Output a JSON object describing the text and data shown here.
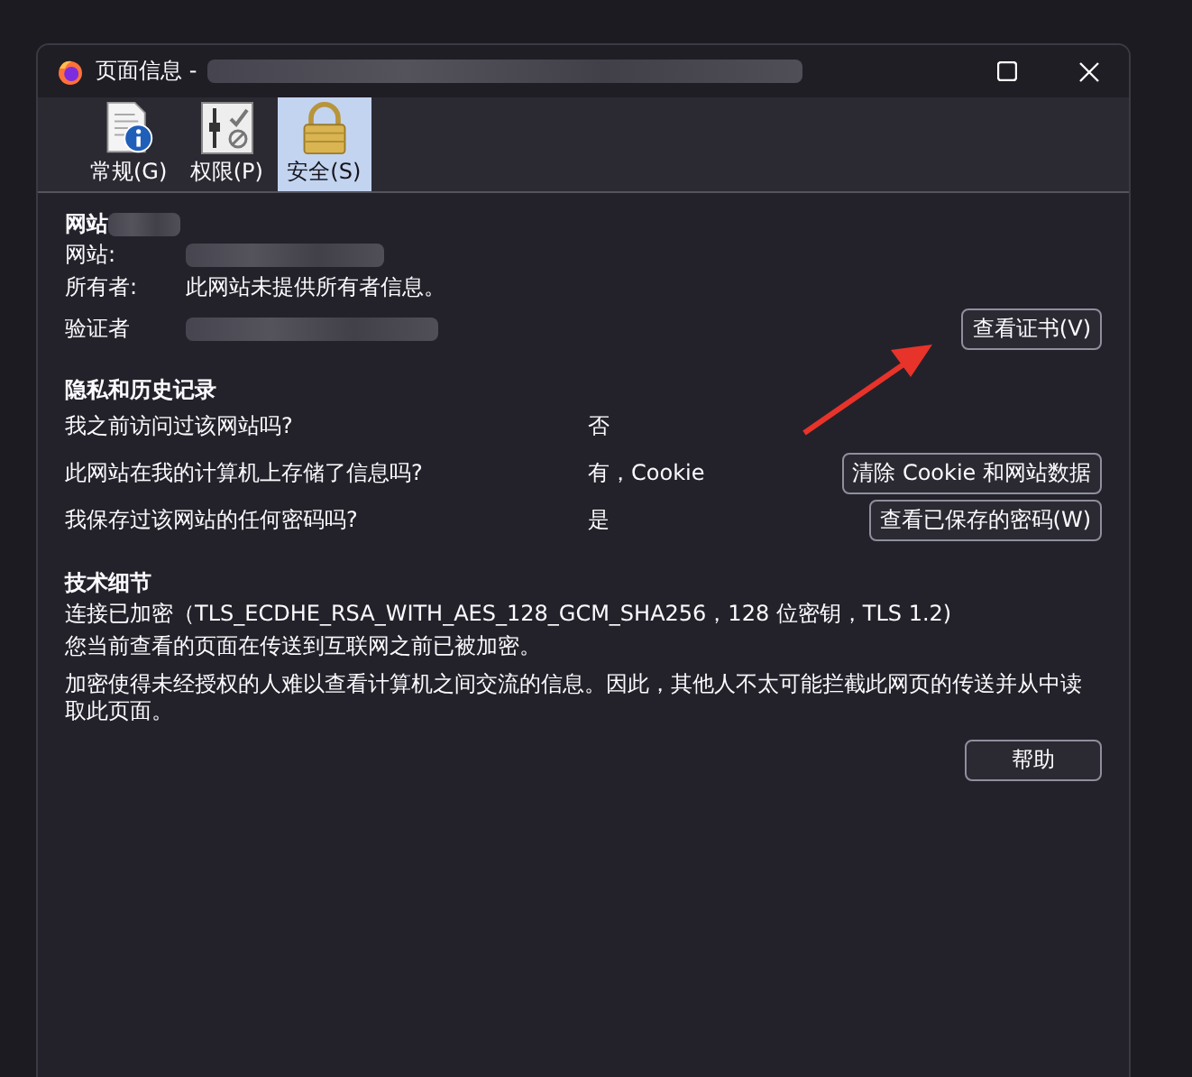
{
  "window": {
    "title": "页面信息 -",
    "title_redacted": true
  },
  "tabs": [
    {
      "label": "常规(G)",
      "kind": "info",
      "selected": false
    },
    {
      "label": "权限(P)",
      "kind": "permissions",
      "selected": false
    },
    {
      "label": "安全(S)",
      "kind": "lock",
      "selected": true
    }
  ],
  "identity": {
    "heading": "网站",
    "heading_redacted": true,
    "rows": [
      {
        "label": "网站:",
        "redacted": true
      },
      {
        "label": "所有者:",
        "value": "此网站未提供所有者信息。",
        "redacted": false
      },
      {
        "label": "验证者",
        "redacted": true
      }
    ],
    "button": "查看证书(V)"
  },
  "privacy": {
    "heading": "隐私和历史记录",
    "rows": [
      {
        "question": "我之前访问过该网站吗?",
        "answer": "否"
      },
      {
        "question": "此网站在我的计算机上存储了信息吗?",
        "answer": "有，Cookie",
        "button": "清除 Cookie 和网站数据"
      },
      {
        "question": "我保存过该网站的任何密码吗?",
        "answer": "是",
        "button": "查看已保存的密码(W)"
      }
    ]
  },
  "technical": {
    "heading": "技术细节",
    "lines": [
      "连接已加密（TLS_ECDHE_RSA_WITH_AES_128_GCM_SHA256，128 位密钥，TLS 1.2)",
      "您当前查看的页面在传送到互联网之前已被加密。",
      "加密使得未经授权的人难以查看计算机之间交流的信息。因此，其他人不太可能拦截此网页的传送并从中读取此页面。"
    ],
    "button": "帮助"
  },
  "annotations": [
    {
      "kind": "arrow"
    }
  ]
}
